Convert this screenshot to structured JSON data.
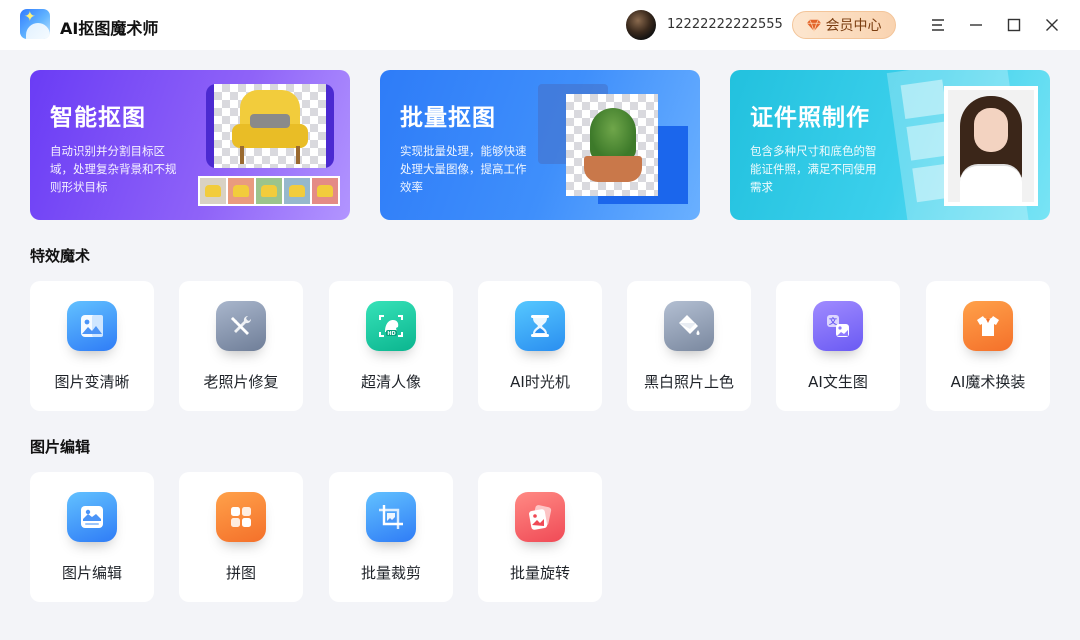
{
  "app": {
    "title": "AI抠图魔术师"
  },
  "user": {
    "id": "12222222222555"
  },
  "header": {
    "vip_label": "会员中心"
  },
  "banners": [
    {
      "title": "智能抠图",
      "desc": "自动识别并分割目标区域，处理复杂背景和不规则形状目标"
    },
    {
      "title": "批量抠图",
      "desc": "实现批量处理，能够快速处理大量图像，提高工作效率"
    },
    {
      "title": "证件照制作",
      "desc": "包含多种尺寸和底色的智能证件照，满足不同使用需求"
    }
  ],
  "sections": {
    "effects": {
      "title": "特效魔术",
      "items": [
        {
          "label": "图片变清晰",
          "icon": "image-enhance-icon"
        },
        {
          "label": "老照片修复",
          "icon": "repair-tools-icon"
        },
        {
          "label": "超清人像",
          "icon": "hd-portrait-icon"
        },
        {
          "label": "AI时光机",
          "icon": "hourglass-icon"
        },
        {
          "label": "黑白照片上色",
          "icon": "paint-bucket-icon"
        },
        {
          "label": "AI文生图",
          "icon": "text-to-image-icon"
        },
        {
          "label": "AI魔术换装",
          "icon": "outfit-change-icon"
        }
      ]
    },
    "editing": {
      "title": "图片编辑",
      "items": [
        {
          "label": "图片编辑",
          "icon": "image-edit-icon"
        },
        {
          "label": "拼图",
          "icon": "collage-icon"
        },
        {
          "label": "批量裁剪",
          "icon": "crop-icon"
        },
        {
          "label": "批量旋转",
          "icon": "rotate-images-icon"
        }
      ]
    }
  },
  "colors": {
    "background": "#f3f4f8",
    "banner_purple": "#6a3cf5",
    "banner_blue": "#2e7cf8",
    "banner_cyan": "#22c1de",
    "vip_text": "#7a3d10"
  }
}
